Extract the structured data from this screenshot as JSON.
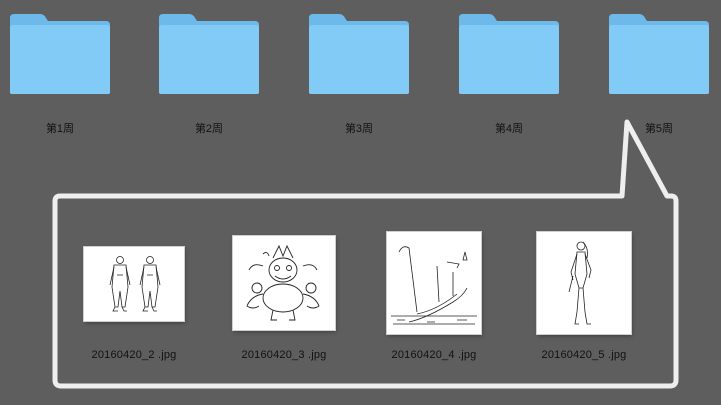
{
  "folders": [
    {
      "label": "第1周",
      "color": "#7ec8f5"
    },
    {
      "label": "第2周",
      "color": "#7ec8f5"
    },
    {
      "label": "第3周",
      "color": "#7ec8f5"
    },
    {
      "label": "第4周",
      "color": "#7ec8f5"
    },
    {
      "label": "第5周",
      "color": "#7ec8f5"
    }
  ],
  "files": [
    {
      "name": "20160420_2 .jpg",
      "icon": "character-sketch-thumbnail"
    },
    {
      "name": "20160420_3 .jpg",
      "icon": "creature-sketch-thumbnail"
    },
    {
      "name": "20160420_4 .jpg",
      "icon": "scene-sketch-thumbnail"
    },
    {
      "name": "20160420_5 .jpg",
      "icon": "figure-sketch-thumbnail"
    }
  ],
  "colors": {
    "background": "#5e5e5e",
    "callout_stroke": "#eeeeee",
    "folder_body": "#7ec8f5",
    "folder_tab": "#6db9ea"
  }
}
